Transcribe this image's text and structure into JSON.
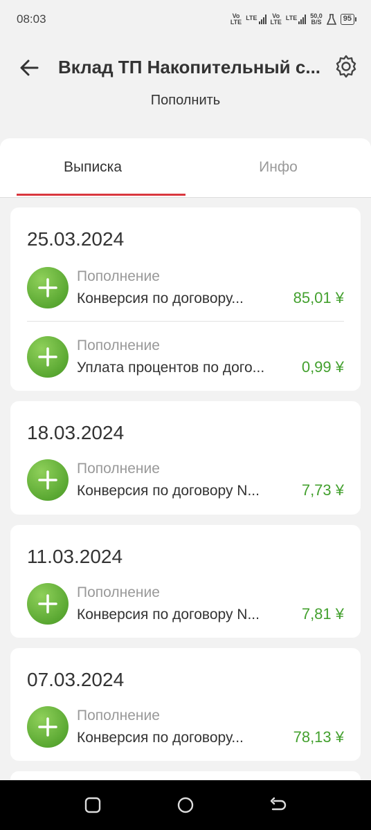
{
  "status_bar": {
    "time": "08:03",
    "sim1_top": "Vo",
    "sim1_bottom": "LTE",
    "lte1": "LTE",
    "sim2_top": "Vo",
    "sim2_bottom": "LTE",
    "lte2": "LTE",
    "speed_value": "50,0",
    "speed_unit": "B/S",
    "battery": "95"
  },
  "header": {
    "title": "Вклад ТП Накопительный с...",
    "topup_label": "Пополнить",
    "back_icon": "arrow-left-icon",
    "settings_icon": "gear-icon"
  },
  "tabs": [
    {
      "label": "Выписка",
      "active": true
    },
    {
      "label": "Инфо",
      "active": false
    }
  ],
  "colors": {
    "accent": "#d9363e",
    "amount": "#43a02e",
    "icon_green": "#5aa832"
  },
  "groups": [
    {
      "date": "25.03.2024",
      "transactions": [
        {
          "type": "Пополнение",
          "description": "Конверсия по договору...",
          "amount": "85,01 ¥"
        },
        {
          "type": "Пополнение",
          "description": "Уплата процентов по дого...",
          "amount": "0,99 ¥"
        }
      ]
    },
    {
      "date": "18.03.2024",
      "transactions": [
        {
          "type": "Пополнение",
          "description": "Конверсия по договору N...",
          "amount": "7,73 ¥"
        }
      ]
    },
    {
      "date": "11.03.2024",
      "transactions": [
        {
          "type": "Пополнение",
          "description": "Конверсия по договору N...",
          "amount": "7,81 ¥"
        }
      ]
    },
    {
      "date": "07.03.2024",
      "transactions": [
        {
          "type": "Пополнение",
          "description": "Конверсия по договору...",
          "amount": "78,13 ¥"
        }
      ]
    }
  ],
  "nav": {
    "recents_icon": "square-icon",
    "home_icon": "circle-icon",
    "back_icon": "back-arrow-icon"
  }
}
